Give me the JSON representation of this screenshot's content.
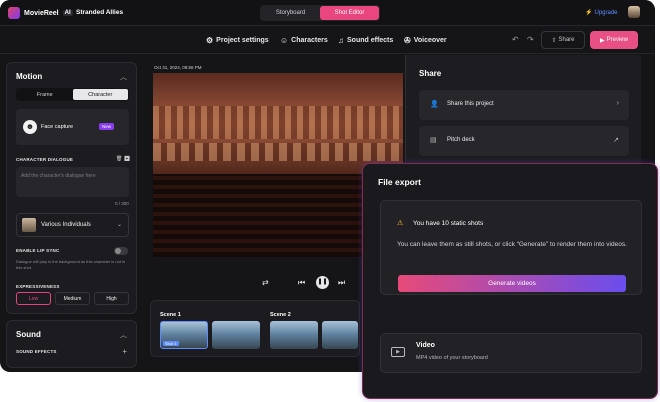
{
  "app": {
    "name": "MovieReel",
    "badge": "AI",
    "project": "Stranded Allies"
  },
  "modes": [
    "Storyboard",
    "Shot Editor"
  ],
  "active_mode": 1,
  "upgrade_label": "Upgrade",
  "toolbar": {
    "project_settings": "Project settings",
    "characters": "Characters",
    "sound_effects": "Sound effects",
    "voiceover": "Voiceover",
    "share": "Share",
    "preview": "Preview"
  },
  "motion": {
    "title": "Motion",
    "tabs": [
      "Frame",
      "Character"
    ],
    "face_capture": "Face capture",
    "new_badge": "New",
    "dialogue_label": "CHARACTER DIALOGUE",
    "dialogue_placeholder": "Add the character's dialogue here",
    "counter": "0 / 300",
    "character": "Various Individuals",
    "lip_sync_label": "ENABLE LIP SYNC",
    "lip_sync_note": "Dialogue will play in the background as this character is not in this shot.",
    "expressiveness_label": "EXPRESSIVENESS",
    "expressiveness": [
      "Low",
      "Medium",
      "High"
    ]
  },
  "sound": {
    "title": "Sound",
    "effects_label": "SOUND EFFECTS"
  },
  "canvas": {
    "timestamp": "Oct 31, 2024, 09:56 PM"
  },
  "scenes": {
    "scene1": "Scene 1",
    "scene2": "Scene 2",
    "shot_tag": "Shot 1"
  },
  "share_panel": {
    "title": "Share",
    "share_project": "Share this project",
    "pitch_deck": "Pitch deck"
  },
  "file_export": {
    "title": "File export",
    "static_title": "You have 10 static shots",
    "static_desc": "You can leave them as still shots, or click “Generate” to render them into videos.",
    "generate": "Generate videos",
    "video_title": "Video",
    "video_sub": "MP4 video of your storyboard"
  }
}
